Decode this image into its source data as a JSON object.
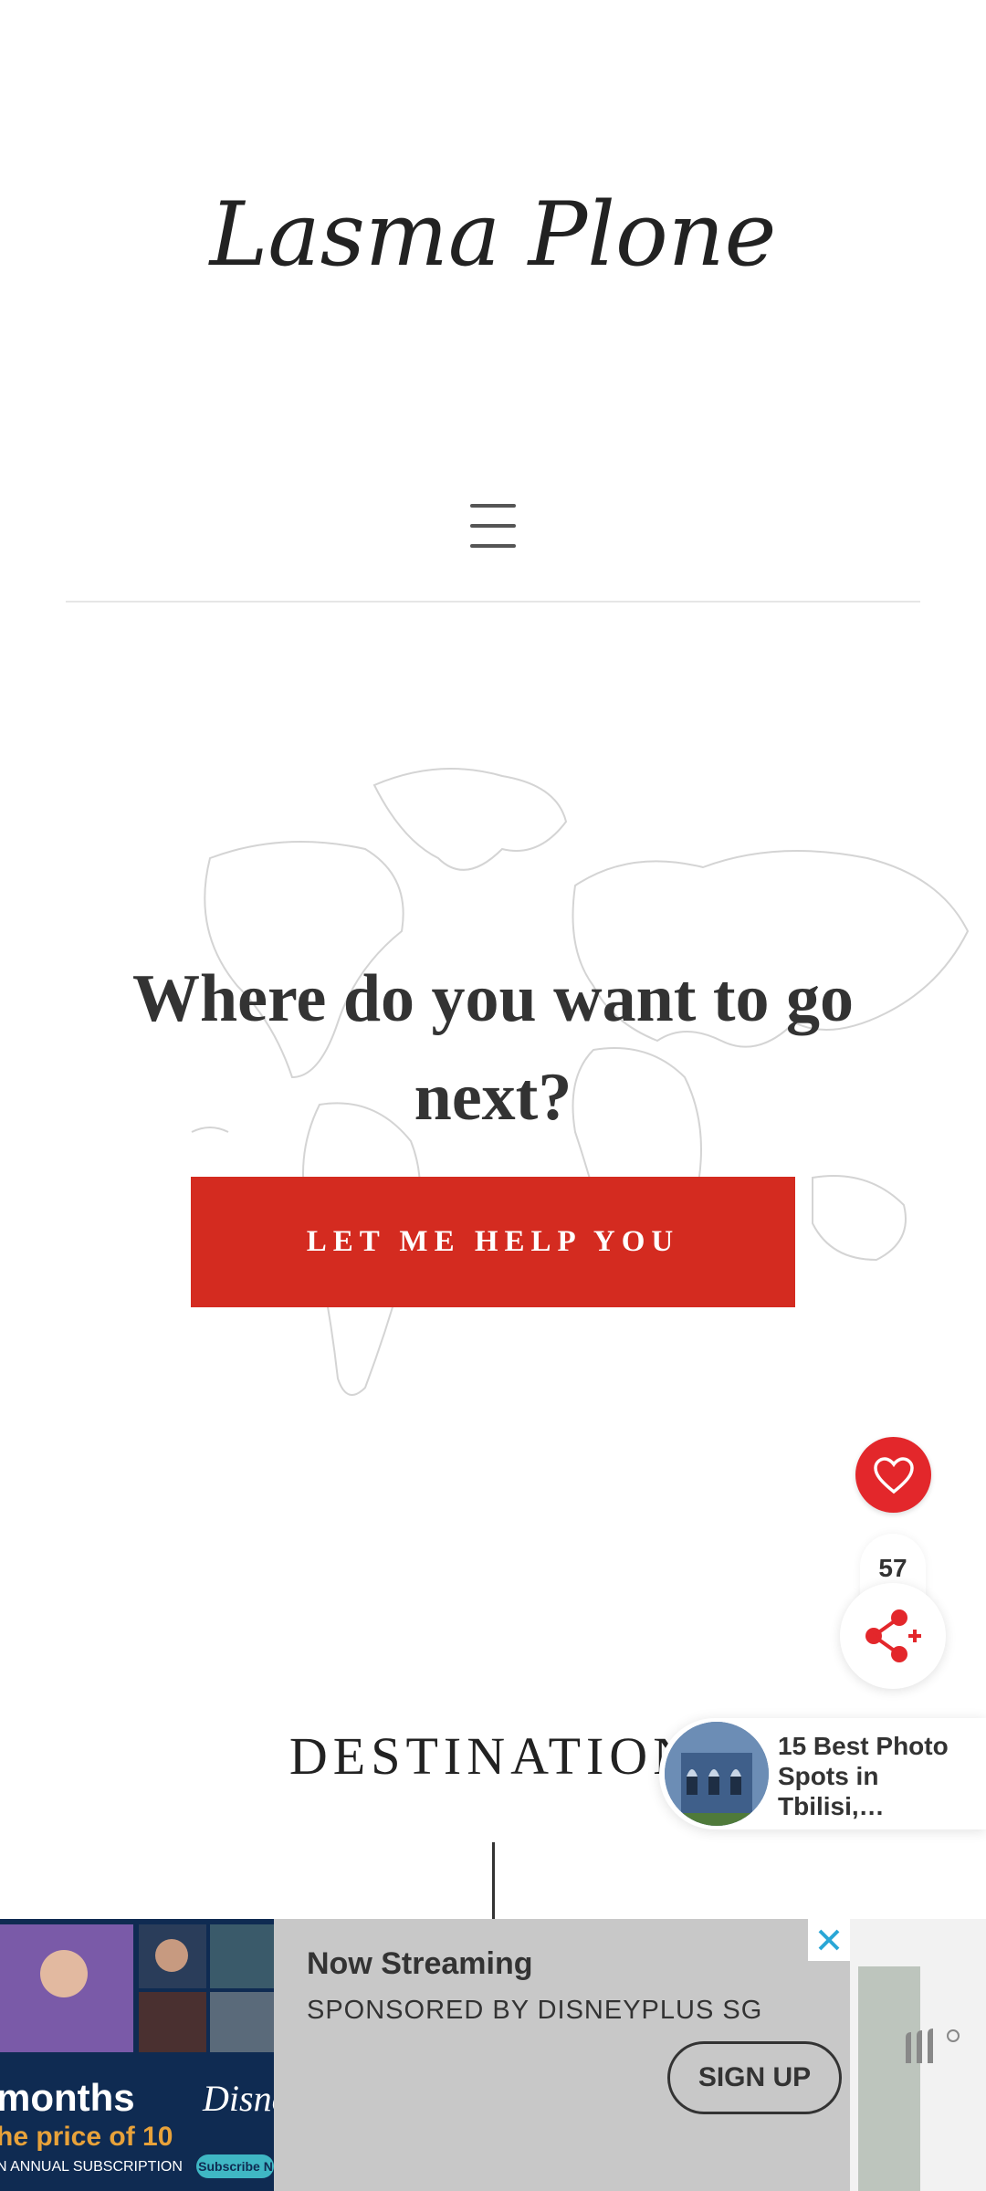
{
  "header": {
    "logo_text": "Lasma Plone",
    "menu_icon": "hamburger-menu-icon"
  },
  "hero": {
    "background_icon": "world-map",
    "title": "Where do you want to go next?",
    "cta_label": "LET ME HELP YOU",
    "cta_color": "#d42b20"
  },
  "floating": {
    "like_icon": "heart-icon",
    "like_color": "#e3272b",
    "share_count": "57",
    "share_icon": "share-plus-icon"
  },
  "section": {
    "title": "DESTINATION"
  },
  "related_post": {
    "title": "15 Best Photo Spots in Tbilisi,…"
  },
  "ad": {
    "creative_line1": "months",
    "creative_line2": "he price of 10",
    "creative_line3": "N ANNUAL SUBSCRIPTION",
    "headline": "Now Streaming",
    "sponsor": "SPONSORED BY DISNEYPLUS SG",
    "cta": "SIGN UP",
    "close_icon": "close-icon"
  }
}
